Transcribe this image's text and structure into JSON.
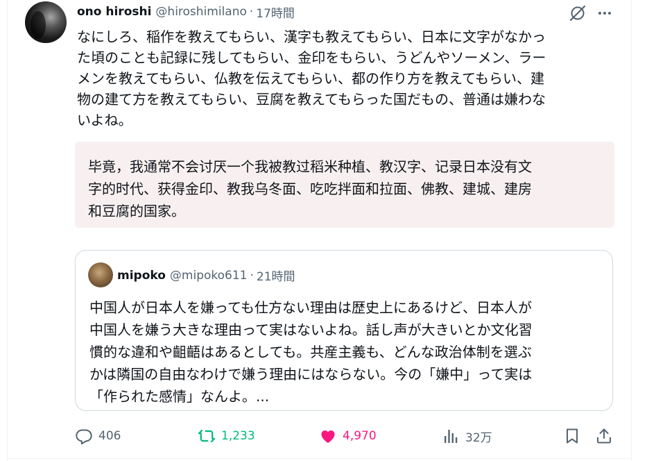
{
  "post": {
    "author_name": "ono hiroshi",
    "handle": "@hiroshimilano",
    "separator": "·",
    "time": "17時間",
    "lines": [
      "なにしろ、稲作を教えてもらい、漢字も教えてもらい、日本に文字がなかっ",
      "た頃のことも記録に残してもらい、金印をもらい、うどんやソーメン、ラー",
      "メンを教えてもらい、仏教を伝えてもらい、都の作り方を教えてもらい、建",
      "物の建て方を教えてもらい、豆腐を教えてもらった国だもの、普通は嫌わな",
      "いよね。"
    ]
  },
  "translation": {
    "lines": [
      "毕竟，我通常不会讨厌一个我被教过稻米种植、教汉字、记录日本没有文",
      "字的时代、获得金印、教我乌冬面、吃吃拌面和拉面、佛教、建城、建房",
      "和豆腐的国家。"
    ]
  },
  "quote": {
    "author_name": "mipoko",
    "handle": "@mipoko611",
    "separator": "·",
    "time": "21時間",
    "lines": [
      "中国人が日本人を嫌っても仕方ない理由は歴史上にあるけど、日本人が",
      "中国人を嫌う大きな理由って実はないよね。話し声が大きいとか文化習",
      "慣的な違和や齟齬はあるとしても。共産主義も、どんな政治体制を選ぶ",
      "かは隣国の自由なわけで嫌う理由にはならない。今の「嫌中」って実は",
      "「作られた感情」なんよ。..."
    ]
  },
  "actions": {
    "replies": "406",
    "reposts": "1,233",
    "likes": "4,970",
    "views": "32万"
  },
  "colors": {
    "text": "#0f1419",
    "muted": "#536471",
    "repost_green": "#00ba7c",
    "like_pink": "#f91880",
    "translation_bg": "#f8f0f0",
    "border": "#cfd9de"
  },
  "icons": {
    "grok": "grok-icon",
    "more": "more-icon",
    "reply": "reply-icon",
    "repost": "repost-icon",
    "like": "heart-icon",
    "views": "views-icon",
    "bookmark": "bookmark-icon",
    "share": "share-icon"
  }
}
